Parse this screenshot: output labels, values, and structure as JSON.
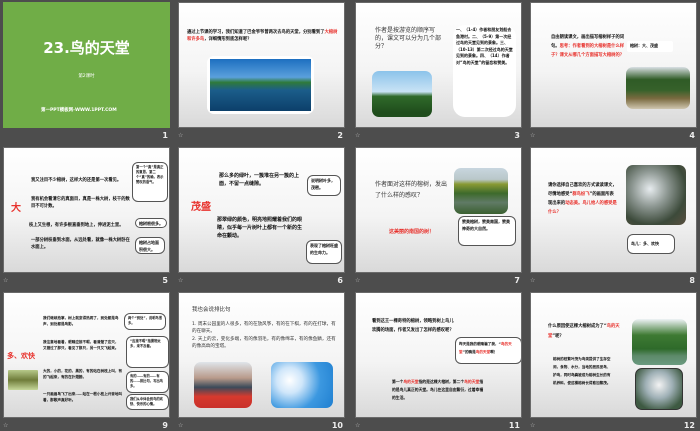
{
  "slides": [
    {
      "number": "1",
      "title": "23.鸟的天堂",
      "subtitle": "第2课时",
      "footer": "第一PPT模板网-WWW.1PPT.COM",
      "bg": "#70ad47"
    },
    {
      "number": "2",
      "text": [
        "通过上节课的学习，我们知道了巴金爷爷曾两次去鸟的天堂，分别看到了",
        "大榕树和许多鸟",
        "，详细情形到底怎样呢？"
      ]
    },
    {
      "number": "3",
      "question": "作者是按游览的顺序写的，课文可以分为几个部分？",
      "bubble": "一、（1-4）作者和朋友划船去鱼港村。二、（5-9）第一次经过鸟的天堂见到的景象。三、（10-13）第二次经过鸟的天堂见到的景象。四、（14）作者对“鸟的天堂”的留恋和赞美。"
    },
    {
      "number": "4",
      "text": "自由朗读课文，画出描写榕树样子的词句。",
      "red": "思考：作者看到的大榕树是什么样子？课文从哪几个方面描写大榕树的？",
      "box": "榕树：大、茂盛"
    },
    {
      "number": "5",
      "keyword": "大",
      "lines": [
        "我又注目不少榕树，这样大的还是第一次看见。",
        "我有机会看清它的真面目，真是一株大树，枝干的数目不可计数。",
        "枝上又生根，有许多根直垂到地上，伸进泥土里。",
        "一部分树枝垂到水面，从远处看，就像一株大树卧在水面上。"
      ],
      "bubbles": [
        "第一个“真”是真正的意思，第二个“真”的确，表示赞叹的语气。",
        "榕树根很多。",
        "榕树占地面积很大。"
      ]
    },
    {
      "number": "6",
      "keyword": "茂盛",
      "lines": [
        "那么多的绿叶，一簇堆在另一簇的上面，不留一点缝隙。",
        "那翠绿的颜色，明亮地照耀着我们的眼睛，似乎每一片树叶上都有一个新的生命在颤动。"
      ],
      "bubbles": [
        "说明树叶多，茂密。",
        "表现了榕树旺盛的生命力。"
      ]
    },
    {
      "number": "7",
      "question": "作者面对这样的榕树，发出了什么样的感叹？",
      "bubble": "赞美榕树，赞美南国，赞美神奇的大自然。",
      "red": "这美丽的南国的树！"
    },
    {
      "number": "8",
      "text": [
        "请你选择自己喜欢的方式读读课文，尽情地感受“",
        "群鸟纷飞",
        "”的画面所表现出来的",
        "动态美。鸟儿给人的感受是什么？"
      ],
      "bubble": "鸟儿：多、欢快"
    },
    {
      "number": "9",
      "keyword": "多、欢快",
      "lines": [
        "我们继续拍掌，树上就变得热闹了，到处都是鸟声，到处都是鸟影。",
        "我注意地看着，眼睛应接不暇，看清楚了这只，又错过了那只，看见了那只，另一只又飞起来。",
        "大的，小的，花的，黑的，有的站在树枝上叫，有的飞起来，有的在扑翅膀。",
        "一只画眉鸟飞了出来……站在一根小枝上兴奋地叫着，那歌声真好听。"
      ],
      "bubbles": [
        "两个“到处”，说明鸟很多。",
        "“应接不暇”指景物太多，来不及看。",
        "有的……有的……有的……排比句，写出鸟多。",
        "我们从中体会到鸟的欢快、快乐的心情。"
      ]
    },
    {
      "number": "10",
      "title": "我也会说排比句",
      "lines": [
        "1. 周末公园里的人很多，有的在放风筝，有的在下棋，有的在打球，有的在聊天。",
        "2. 天上的云，变化多端，有的像羽毛，有的像绵羊，有的像鱼鳞，还有的像高耸的宝塔。"
      ]
    },
    {
      "number": "11",
      "text": "看到这王一棵奇特的榕树，领略到树上鸟儿欢腾的场面，作者又发出了怎样的感叹呢？",
      "bubble": [
        "昨天是我的眼睛骗了我，“",
        "鸟的天堂",
        "”的确是",
        "鸟的天堂",
        "啊！"
      ],
      "bottom": [
        "第一个",
        "鸟的天堂",
        "指的是这棵大榕树，第二个",
        "鸟的天堂",
        "指的是鸟儿真正的天堂。鸟儿在这里自由繁衍，过着幸福的生活。"
      ]
    },
    {
      "number": "12",
      "question": [
        "什么原因使这棵大榕树成为了“",
        "鸟的天堂",
        "”呢？"
      ],
      "text": "榕树的枝繁叶茂为鸟类提供了生存空间，食物、水分，当地的居民爱鸟、护鸟，同时鸟粪被成为榕树生长的有机养料，使这棵榕树长得愈加繁茂。"
    }
  ],
  "animation_icon": "☆"
}
